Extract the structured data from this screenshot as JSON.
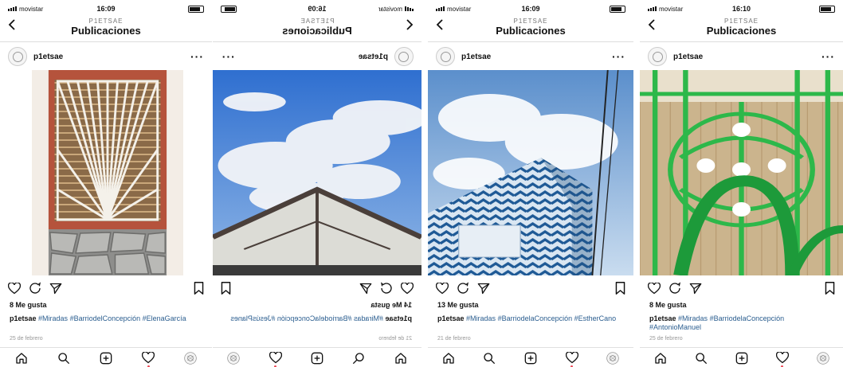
{
  "phones": [
    {
      "carrier": "movistar",
      "time": "16:09",
      "header_sub": "P1ETSAE",
      "header_title": "Publicaciones",
      "username": "p1etsae",
      "likes": "8 Me gusta",
      "caption_user": "p1etsae",
      "caption_tags": "#Miradas #BarriodelConcepción #ElenaGarcía",
      "date": "25 de febrero"
    },
    {
      "carrier": "movistar",
      "time": "16:09",
      "header_sub": "P1ETSAE",
      "header_title": "Publicaciones",
      "username": "p1etsae",
      "likes": "14 Me gusta",
      "caption_user": "p1etsae",
      "caption_tags": "#Miradas #BarriodelaConcepción #JesúsPlanes",
      "date": "21 de febrero"
    },
    {
      "carrier": "movistar",
      "time": "16:09",
      "header_sub": "P1ETSAE",
      "header_title": "Publicaciones",
      "username": "p1etsae",
      "likes": "13 Me gusta",
      "caption_user": "p1etsae",
      "caption_tags": "#Miradas #BarriodelaConcepción #EstherCano",
      "date": "21 de febrero"
    },
    {
      "carrier": "movistar",
      "time": "16:10",
      "header_sub": "P1ETSAE",
      "header_title": "Publicaciones",
      "username": "p1etsae",
      "likes": "8 Me gusta",
      "caption_user": "p1etsae",
      "caption_tags": "#Miradas #BarriodelaConcepción #AntonioManuel",
      "date": "25 de febrero"
    }
  ],
  "icons": {
    "back": "chevron-left-icon",
    "more": "more-dots-icon",
    "like": "heart-icon",
    "comment": "comment-icon",
    "share": "paper-plane-icon",
    "save": "bookmark-icon",
    "home": "home-icon",
    "search": "search-icon",
    "add": "add-post-icon",
    "activity": "heart-icon",
    "profile": "profile-avatar-icon"
  },
  "colors": {
    "hashtag": "#2a5d8f",
    "notification": "#ed4956"
  }
}
